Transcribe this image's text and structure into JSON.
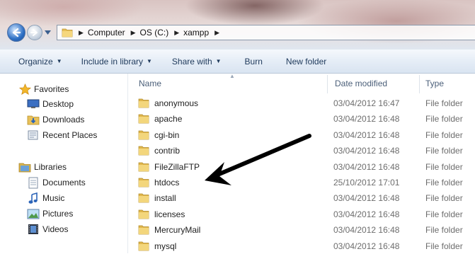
{
  "address": {
    "breadcrumbs": [
      "Computer",
      "OS (C:)",
      "xampp"
    ]
  },
  "toolbar": {
    "organize": "Organize",
    "include_in_library": "Include in library",
    "share_with": "Share with",
    "burn": "Burn",
    "new_folder": "New folder"
  },
  "navpane": {
    "favorites": {
      "label": "Favorites",
      "items": [
        {
          "label": "Desktop",
          "icon": "desktop-icon"
        },
        {
          "label": "Downloads",
          "icon": "downloads-icon"
        },
        {
          "label": "Recent Places",
          "icon": "recent-places-icon"
        }
      ]
    },
    "libraries": {
      "label": "Libraries",
      "items": [
        {
          "label": "Documents",
          "icon": "documents-icon"
        },
        {
          "label": "Music",
          "icon": "music-icon"
        },
        {
          "label": "Pictures",
          "icon": "pictures-icon"
        },
        {
          "label": "Videos",
          "icon": "videos-icon"
        }
      ]
    }
  },
  "columns": {
    "name": "Name",
    "date_modified": "Date modified",
    "type": "Type"
  },
  "files": [
    {
      "name": "anonymous",
      "date": "03/04/2012 16:47",
      "type": "File folder"
    },
    {
      "name": "apache",
      "date": "03/04/2012 16:48",
      "type": "File folder"
    },
    {
      "name": "cgi-bin",
      "date": "03/04/2012 16:48",
      "type": "File folder"
    },
    {
      "name": "contrib",
      "date": "03/04/2012 16:48",
      "type": "File folder"
    },
    {
      "name": "FileZillaFTP",
      "date": "03/04/2012 16:48",
      "type": "File folder"
    },
    {
      "name": "htdocs",
      "date": "25/10/2012 17:01",
      "type": "File folder"
    },
    {
      "name": "install",
      "date": "03/04/2012 16:48",
      "type": "File folder"
    },
    {
      "name": "licenses",
      "date": "03/04/2012 16:48",
      "type": "File folder"
    },
    {
      "name": "MercuryMail",
      "date": "03/04/2012 16:48",
      "type": "File folder"
    },
    {
      "name": "mysql",
      "date": "03/04/2012 16:48",
      "type": "File folder"
    }
  ],
  "colors": {
    "toolbar_text": "#1e395b",
    "secondary_text": "#6d6d6d",
    "annotation_arrow": "#000000"
  }
}
